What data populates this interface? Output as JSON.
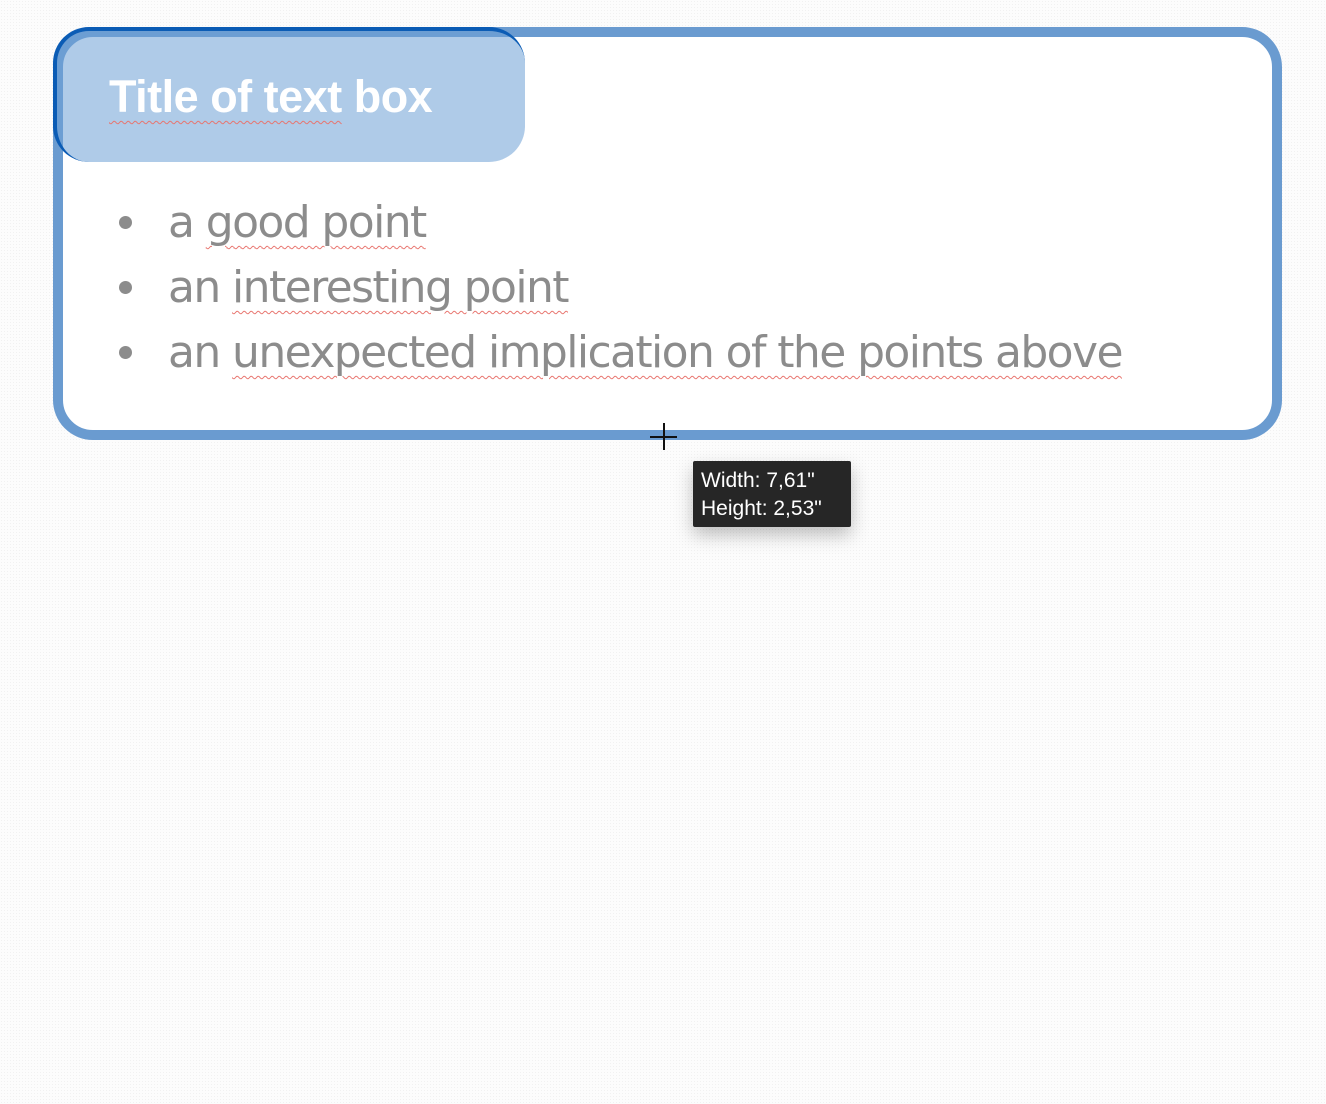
{
  "slide": {
    "title": "Title of text box",
    "bullets": [
      {
        "parts": [
          {
            "text": "a ",
            "misspelled": false
          },
          {
            "text": "good point",
            "misspelled": true
          }
        ]
      },
      {
        "parts": [
          {
            "text": "an ",
            "misspelled": false
          },
          {
            "text": "interesting point",
            "misspelled": true
          }
        ]
      },
      {
        "parts": [
          {
            "text": "an ",
            "misspelled": false
          },
          {
            "text": "unexpected implication of the points above",
            "misspelled": true
          }
        ]
      }
    ],
    "colors": {
      "frame_border": "#6a9bd0",
      "title_fill": "#a7c5e8",
      "title_edge": "#0b5cb5",
      "bullet_text": "#8c8c8c",
      "spellcheck": "#e8756f"
    }
  },
  "resize_tooltip": {
    "width_line": "Width: 7,61\"",
    "height_line": "Height: 2,53\""
  },
  "cursor": {
    "icon": "crosshair-icon"
  }
}
